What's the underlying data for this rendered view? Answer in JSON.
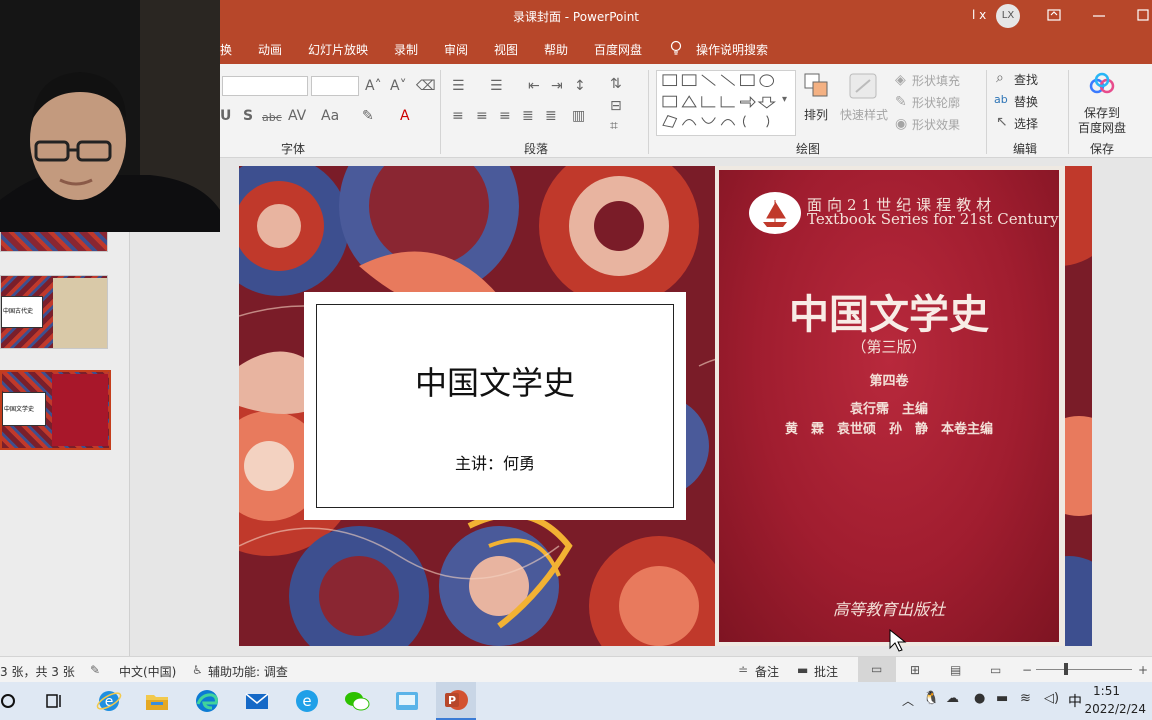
{
  "window": {
    "title": "录课封面 - PowerPoint",
    "user_label": "l x",
    "avatar_initials": "LX",
    "accent": "#b7472a"
  },
  "menu": {
    "tabs": [
      "换",
      "动画",
      "幻灯片放映",
      "录制",
      "审阅",
      "视图",
      "帮助",
      "百度网盘"
    ],
    "tell_me": "操作说明搜索"
  },
  "ribbon": {
    "font_group": "字体",
    "paragraph_group": "段落",
    "drawing_group": "绘图",
    "editing_group": "编辑",
    "save_group": "保存",
    "arrange_label": "排列",
    "quick_styles_label": "快速样式",
    "shape_fill_label": "形状填充",
    "shape_outline_label": "形状轮廓",
    "shape_effects_label": "形状效果",
    "find_label": "查找",
    "replace_label": "替换",
    "select_label": "选择",
    "save_to_baidu_line1": "保存到",
    "save_to_baidu_line2": "百度网盘"
  },
  "slide": {
    "title": "中国文学史",
    "subtitle": "主讲：何勇",
    "book": {
      "series_cn": "面向21世纪课程教材",
      "series_en": "Textbook Series for 21st Century",
      "title": "中国文学史",
      "edition": "（第三版）",
      "volume": "第四卷",
      "chief_editor": "袁行霈　主编",
      "volume_editors": "黄　霖　袁世硕　孙　静　本卷主编",
      "publisher": "高等教育出版社"
    }
  },
  "thumbnails": {
    "slide2_text": "中国古代史",
    "slide3_text": "中国文学史"
  },
  "status": {
    "slide_count": "3 张，共 3 张",
    "language": "中文(中国)",
    "accessibility": "辅助功能: 调查",
    "notes": "备注",
    "comments": "批注"
  },
  "taskbar": {
    "ime": "中",
    "time": "1:51",
    "date": "2022/2/24"
  }
}
